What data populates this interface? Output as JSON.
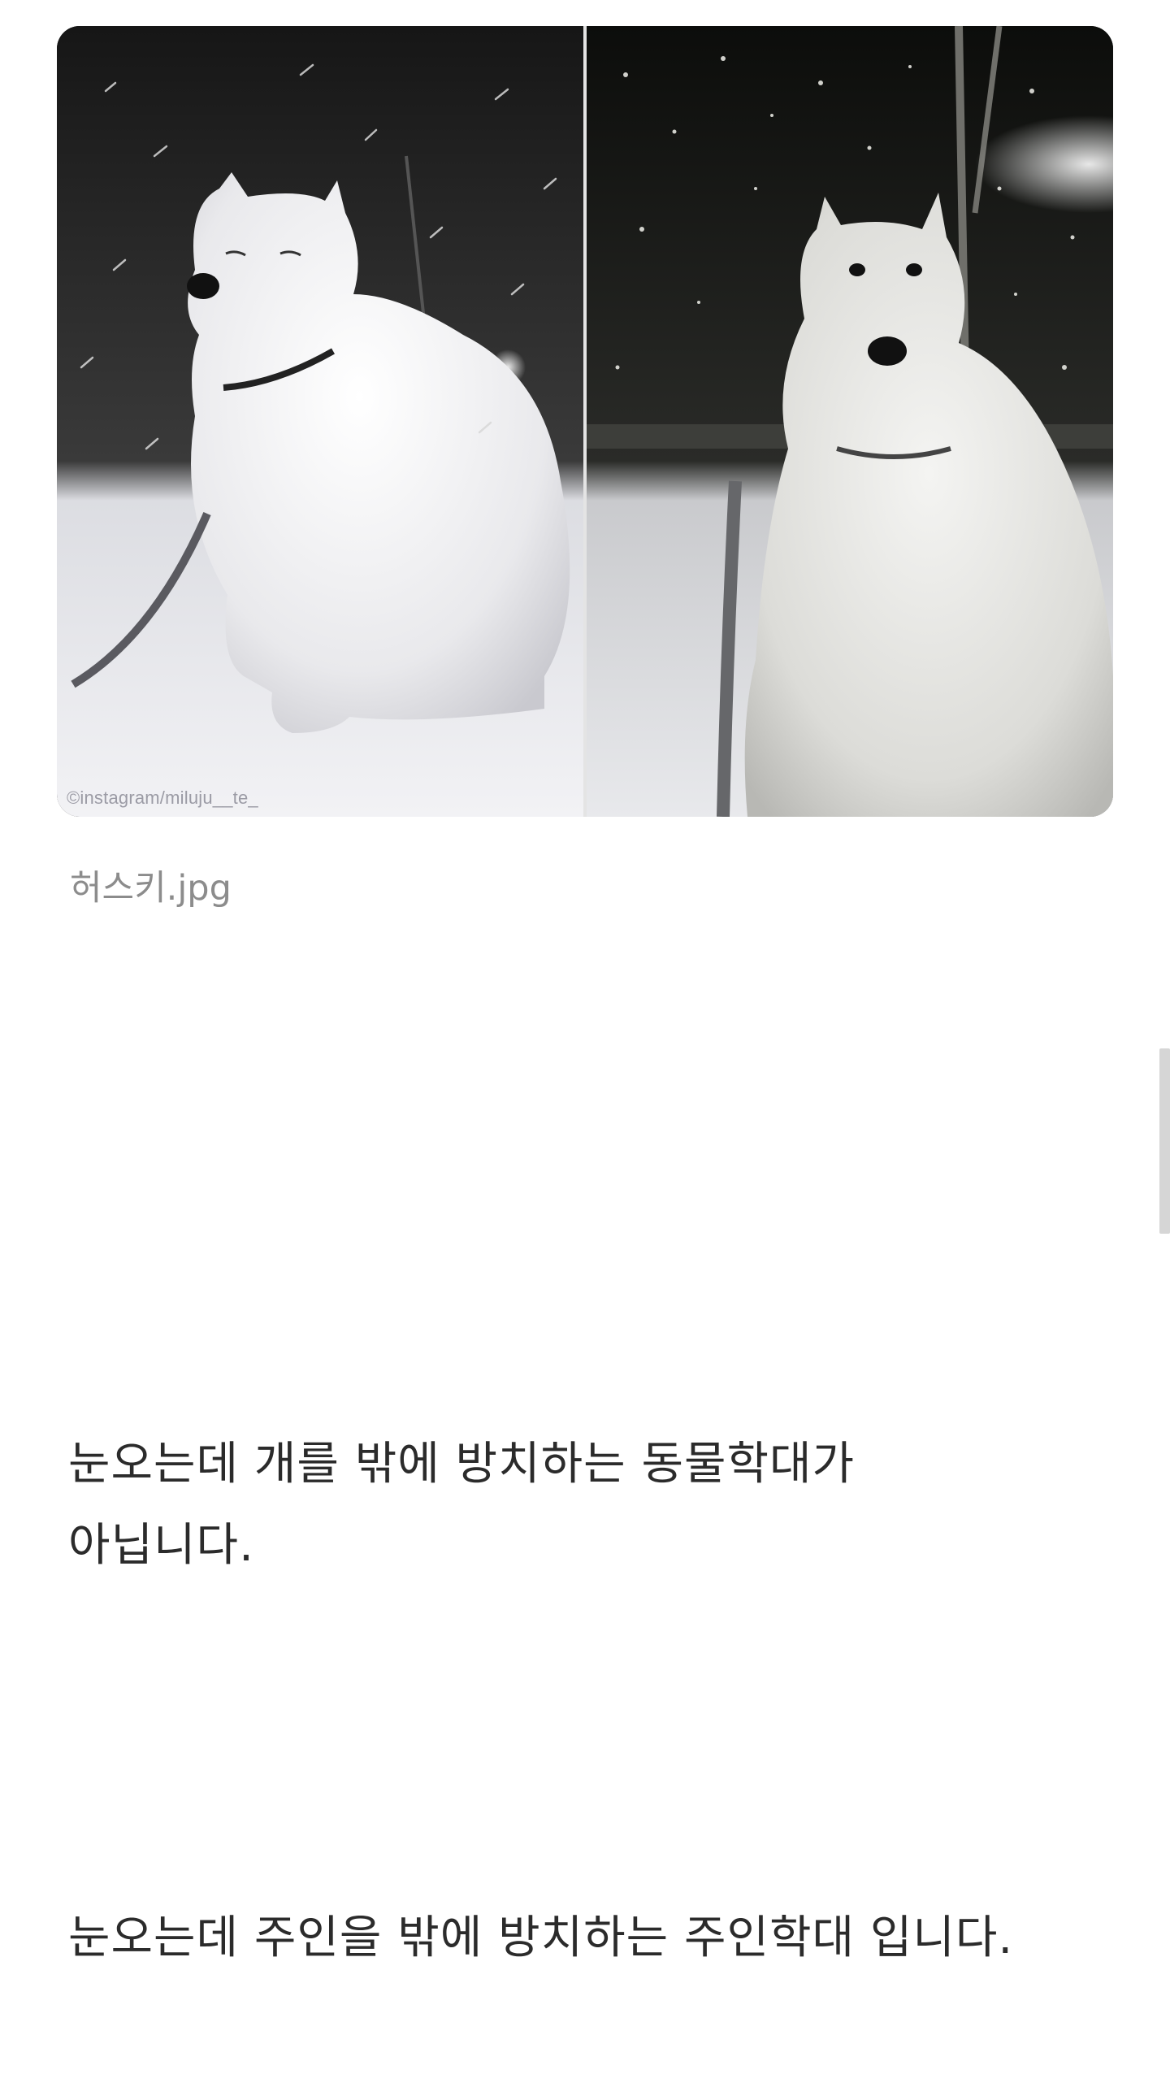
{
  "image": {
    "alt": "husky sitting in snow at night (two photos)",
    "watermark": "©instagram/miluju__te_"
  },
  "caption": "허스키.jpg",
  "paragraphs": [
    {
      "line1": "눈오는데 개를 밖에 방치하는 동물학대가",
      "line2": "아닙니다."
    },
    {
      "line1": "눈오는데 주인을 밖에 방치하는 주인학대 입니다."
    }
  ],
  "colors": {
    "caption": "#8c8c8c",
    "text": "#2b2b2b",
    "background": "#ffffff",
    "scrollbar": "#d6d6d6"
  }
}
